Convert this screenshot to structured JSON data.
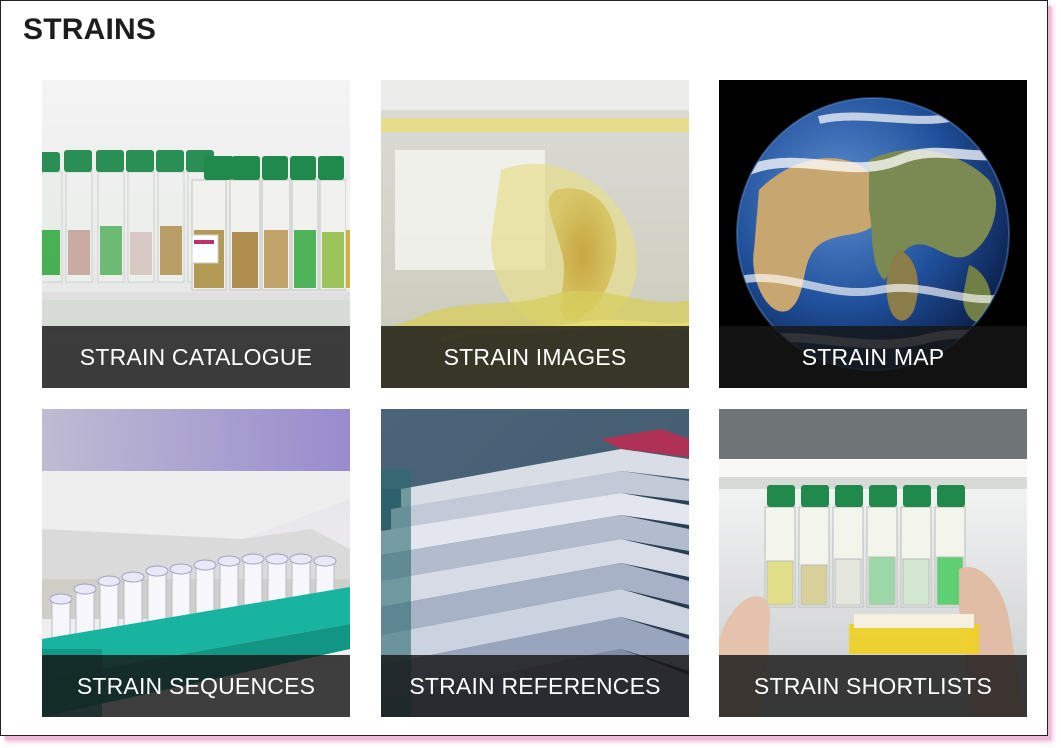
{
  "page": {
    "title": "STRAINS"
  },
  "tiles": [
    {
      "label": "STRAIN CATALOGUE",
      "image": "culture-flasks-photo"
    },
    {
      "label": "STRAIN IMAGES",
      "image": "algae-sample-photo"
    },
    {
      "label": "STRAIN MAP",
      "image": "earth-globe-photo"
    },
    {
      "label": "STRAIN SEQUENCES",
      "image": "sample-tubes-rack-photo"
    },
    {
      "label": "STRAIN REFERENCES",
      "image": "paper-stack-photo"
    },
    {
      "label": "STRAIN SHORTLISTS",
      "image": "flasks-in-hands-photo"
    }
  ],
  "colors": {
    "caption_bg": "#161616",
    "title": "#1d1d1d",
    "frame_shadow": "#f2b7d6",
    "cap_green": "#1f8a4c",
    "rack_teal": "#19b4a0"
  }
}
